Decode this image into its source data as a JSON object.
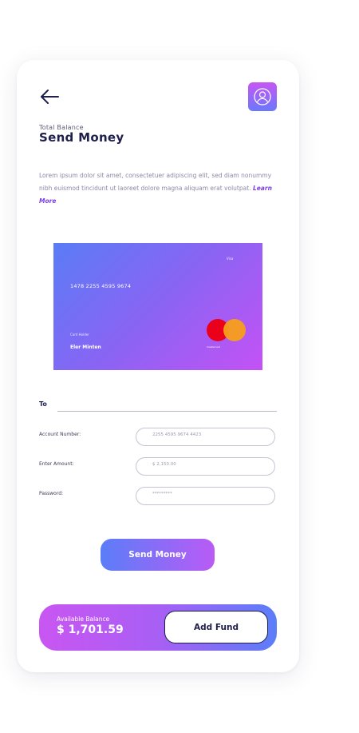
{
  "header": {
    "subtitle": "Total Balance",
    "title": "Send Money"
  },
  "intro": {
    "text": "Lorem ipsum dolor sit amet, consectetuer adipiscing elit, sed diam nonummy nibh euismod tincidunt ut laoreet dolore magna aliquam erat volutpat.",
    "learn_more": "Learn More"
  },
  "card": {
    "brand": "Visa",
    "number": "1478 2255 4595 9674",
    "holder_label": "Card Holder",
    "holder_name": "Eler Minten",
    "network_label": "mastercard",
    "colors": {
      "start": "#5a7cf6",
      "end": "#c452f5"
    }
  },
  "form": {
    "to_label": "To",
    "fields": [
      {
        "label": "Account Number:",
        "value": "2255 4595 9674 4423"
      },
      {
        "label": "Enter Amount:",
        "value": "$ 2,150.00"
      },
      {
        "label": "Password:",
        "value": "*********"
      }
    ],
    "submit_label": "Send Money"
  },
  "balance": {
    "label": "Available Balance",
    "value": "$ 1,701.59",
    "add_fund_label": "Add Fund"
  },
  "icons": {
    "back": "arrow-left-icon",
    "profile": "user-circle-icon"
  }
}
